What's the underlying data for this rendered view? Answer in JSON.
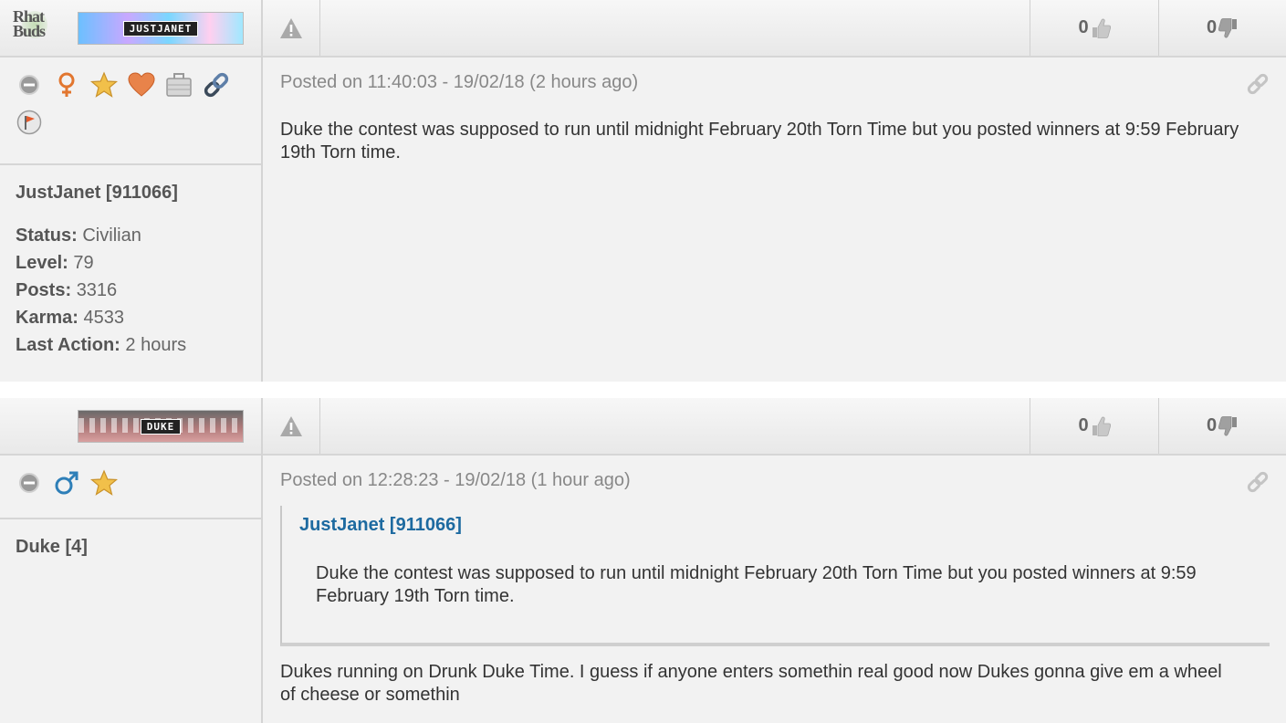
{
  "posts": [
    {
      "faction_logo": [
        "Rhat",
        "Buds"
      ],
      "banner_name": "JUSTJANET",
      "votes": {
        "up": "0",
        "down": "0"
      },
      "meta": "Posted on 11:40:03 - 19/02/18 (2 hours ago)",
      "body": "Duke the contest was supposed to run until midnight February 20th Torn Time but you posted winners at 9:59 February 19th Torn time.",
      "user_name": "JustJanet [911066]",
      "stats": [
        {
          "label": "Status:",
          "value": "Civilian"
        },
        {
          "label": "Level:",
          "value": "79"
        },
        {
          "label": "Posts:",
          "value": "3316"
        },
        {
          "label": "Karma:",
          "value": "4533"
        },
        {
          "label": "Last Action:",
          "value": "2 hours"
        }
      ],
      "icons": [
        "offline-status-icon",
        "female-icon",
        "donator-star-icon",
        "married-heart-icon",
        "job-briefcase-icon",
        "chain-link-icon",
        "faction-flag-icon"
      ]
    },
    {
      "banner_name": "DUKE",
      "votes": {
        "up": "0",
        "down": "0"
      },
      "meta": "Posted on 12:28:23 - 19/02/18 (1 hour ago)",
      "quote": {
        "author": "JustJanet [911066]",
        "text": "Duke the contest was supposed to run until midnight February 20th Torn Time but you posted winners at 9:59 February 19th Torn time."
      },
      "body": "Dukes running on Drunk Duke Time. I guess if anyone enters somethin real good now Dukes gonna give em a wheel of cheese or somethin",
      "user_name": "Duke [4]",
      "icons": [
        "offline-status-icon",
        "male-icon",
        "donator-star-icon"
      ]
    }
  ],
  "colors": {
    "panel_bg": "#f2f2f2",
    "border": "#d4d4d4",
    "quote_author": "#1d6aa0",
    "meta_text": "#888888"
  }
}
